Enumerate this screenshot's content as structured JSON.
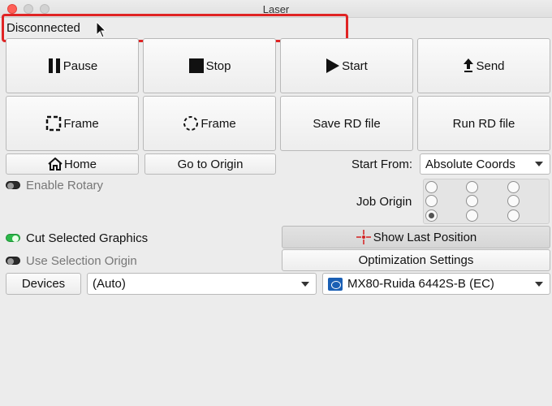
{
  "window": {
    "title": "Laser"
  },
  "status": {
    "text": "Disconnected"
  },
  "buttons": {
    "pause": "Pause",
    "stop": "Stop",
    "start": "Start",
    "send": "Send",
    "frame": "Frame",
    "frame_circle": "Frame",
    "save_rd": "Save RD file",
    "run_rd": "Run RD file",
    "home": "Home",
    "go_to_origin": "Go to Origin",
    "show_last_position": "Show Last Position",
    "optimization_settings": "Optimization Settings",
    "devices": "Devices"
  },
  "start_from": {
    "label": "Start From:",
    "value": "Absolute Coords"
  },
  "job_origin": {
    "label": "Job Origin",
    "selected_index": 6
  },
  "options": {
    "enable_rotary": {
      "label": "Enable Rotary",
      "on": false
    },
    "cut_selected_graphics": {
      "label": "Cut Selected Graphics",
      "on": true
    },
    "use_selection_origin": {
      "label": "Use Selection Origin",
      "on": false
    }
  },
  "port": {
    "value": "(Auto)"
  },
  "device": {
    "value": "MX80-Ruida 6442S-B (EC)"
  },
  "icons": [
    "pause-icon",
    "stop-icon",
    "play-icon",
    "upload-arrow-icon",
    "frame-square-icon",
    "frame-circle-icon",
    "home-icon",
    "crosshair-icon",
    "caret-down-icon",
    "ruida-logo-icon",
    "mouse-cursor-icon"
  ],
  "colors": {
    "highlight_red": "#e02424",
    "toggle_on": "#2db84a",
    "close_button": "#ff5f57"
  }
}
